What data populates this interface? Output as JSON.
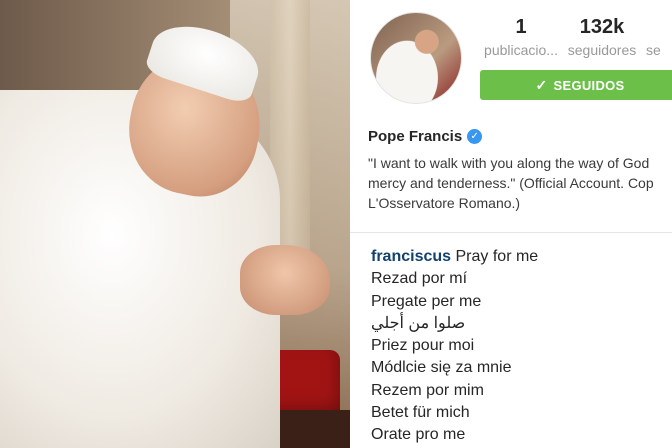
{
  "profile": {
    "posts": {
      "count": "1",
      "label": "publicacio..."
    },
    "followers": {
      "count": "132k",
      "label": "seguidores"
    },
    "following": {
      "label": "se"
    },
    "follow_button": "SEGUIDOS",
    "name": "Pope Francis",
    "bio_lines": [
      "\"I want to walk with you along the way of God",
      "mercy and tenderness.\" (Official Account. Cop",
      "L'Osservatore Romano.)"
    ]
  },
  "post_caption": {
    "username": "franciscus",
    "first_line": "Pray for me",
    "lines": [
      "Rezad por mí",
      "Pregate per me",
      "صلوا من أجلي",
      "Priez pour moi",
      "Módlcie się za mnie",
      "Rezem por mim",
      "Betet für mich",
      "Orate pro me"
    ]
  },
  "icons": {
    "verified": "verified-badge-icon",
    "check": "check-icon"
  },
  "colors": {
    "follow_button_bg": "#6cc04a",
    "verified_blue": "#3897f0",
    "username_color": "#12426e"
  }
}
